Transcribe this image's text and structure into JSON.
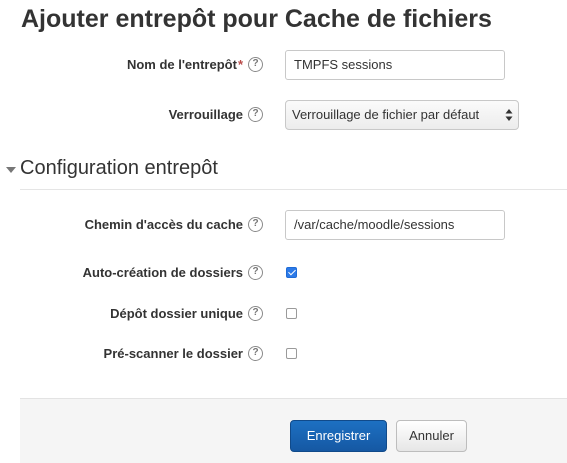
{
  "page": {
    "title": "Ajouter entrepôt pour Cache de fichiers"
  },
  "form": {
    "store_name": {
      "label": "Nom de l'entrepôt",
      "required_mark": "*",
      "value": "TMPFS sessions"
    },
    "locking": {
      "label": "Verrouillage",
      "selected": "Verrouillage de fichier par défaut"
    },
    "section": {
      "title": "Configuration entrepôt"
    },
    "cache_path": {
      "label": "Chemin d'accès du cache",
      "value": "/var/cache/moodle/sessions"
    },
    "autocreate": {
      "label": "Auto-création de dossiers",
      "checked": true
    },
    "single_folder": {
      "label": "Dépôt dossier unique",
      "checked": false
    },
    "prescan": {
      "label": "Pré-scanner le dossier",
      "checked": false
    },
    "help_glyph": "?"
  },
  "buttons": {
    "save": "Enregistrer",
    "cancel": "Annuler"
  },
  "icons": {
    "help": "help-icon",
    "collapse": "collapse-arrow-icon",
    "select": "select-arrows-icon"
  },
  "colors": {
    "primary": "#1d70c2",
    "checkbox_checked": "#2c7ae8",
    "required": "#b94a48"
  }
}
